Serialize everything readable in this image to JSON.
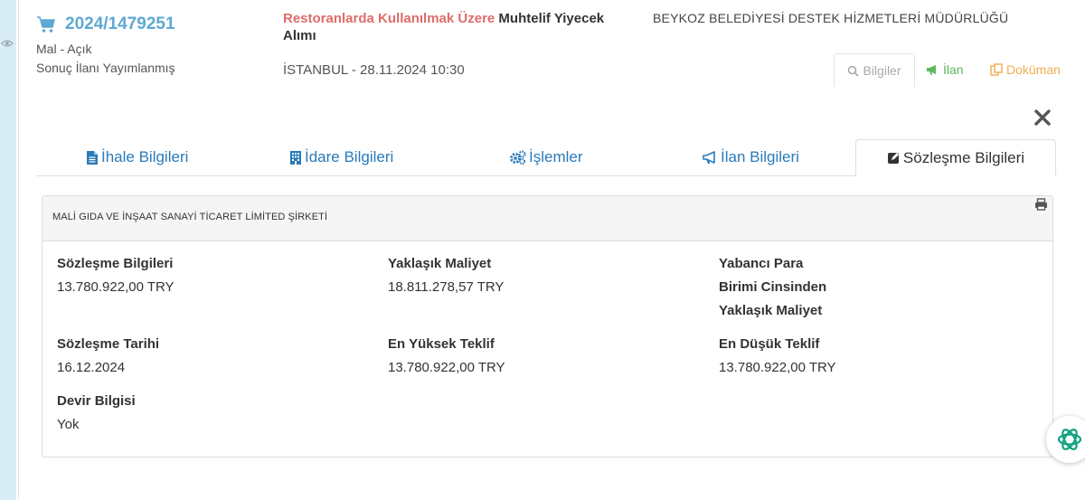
{
  "tender": {
    "number": "2024/1479251",
    "category": "Mal - Açık",
    "status": "Sonuç İlanı Yayımlanmış",
    "title_highlight": "Restoranlarda Kullanılmak Üzere",
    "title_rest": " Muhtelif Yiyecek Alımı",
    "city_date": "İSTANBUL - 28.11.2024 10:30",
    "organization": "BEYKOZ BELEDİYESİ DESTEK HİZMETLERİ MÜDÜRLÜĞÜ"
  },
  "actions": {
    "info": "Bilgiler",
    "announcement": "İlan",
    "document": "Doküman"
  },
  "tabs": [
    {
      "label": "İhale Bilgileri"
    },
    {
      "label": "İdare Bilgileri"
    },
    {
      "label": "İşlemler"
    },
    {
      "label": "İlan Bilgileri"
    },
    {
      "label": "Sözleşme Bilgileri",
      "active": true
    }
  ],
  "contract": {
    "company": "MALİ GIDA VE İNŞAAT SANAYİ TİCARET LİMİTED ŞİRKETİ",
    "fields": {
      "contract_info": {
        "label": "Sözleşme Bilgileri",
        "value": "13.780.922,00 TRY"
      },
      "approx_cost": {
        "label": "Yaklaşık Maliyet",
        "value": "18.811.278,57 TRY"
      },
      "foreign_cost": {
        "label_line1": "Yabancı Para",
        "label_line2": "Birimi Cinsinden",
        "label_line3": "Yaklaşık Maliyet"
      },
      "contract_date": {
        "label": "Sözleşme Tarihi",
        "value": "16.12.2024"
      },
      "highest_bid": {
        "label": "En Yüksek Teklif",
        "value": "13.780.922,00 TRY"
      },
      "lowest_bid": {
        "label": "En Düşük Teklif",
        "value": "13.780.922,00 TRY"
      },
      "transfer": {
        "label": "Devir Bilgisi",
        "value": "Yok"
      }
    }
  },
  "colors": {
    "link_blue": "#2a7ab9",
    "number_blue": "#5fa8d3",
    "highlight_red": "#d9534f",
    "announce_green": "#5cb85c",
    "doc_orange": "#f0ad4e",
    "rail_blue": "#d9edf7"
  }
}
